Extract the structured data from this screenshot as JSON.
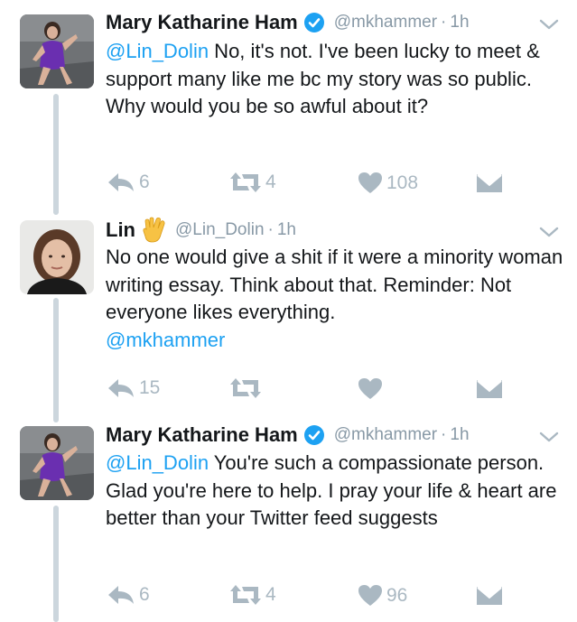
{
  "tweets": [
    {
      "name": "Mary Katharine Ham",
      "verified": true,
      "handle": "@mkhammer",
      "time": "1h",
      "mention": "@Lin_Dolin",
      "text": " No, it's not. I've been lucky to meet & support many like me bc my story was so public. Why would you be so awful about it?",
      "reply_count": "6",
      "retweet_count": "4",
      "like_count": "108"
    },
    {
      "name": "Lin",
      "emoji": "vulcan-salute-emoji",
      "handle": "@Lin_Dolin",
      "time": "1h",
      "text": "No one would give a shit if it were a minority woman writing essay. Think about that. Reminder: Not everyone likes everything.",
      "trailing_mention": "@mkhammer",
      "reply_count": "15",
      "retweet_count": "",
      "like_count": ""
    },
    {
      "name": "Mary Katharine Ham",
      "verified": true,
      "handle": "@mkhammer",
      "time": "1h",
      "mention": "@Lin_Dolin",
      "text": " You're such a compassionate person. Glad you're here to help. I pray your life & heart are better than your Twitter feed suggests",
      "reply_count": "6",
      "retweet_count": "4",
      "like_count": "96"
    }
  ],
  "dot": "·",
  "colors": {
    "text": "#14171a",
    "muted": "#8899a6",
    "action": "#aab8c2",
    "link": "#1da1f2",
    "thread_line": "#ccd6dd",
    "verified": "#1da1f2"
  }
}
